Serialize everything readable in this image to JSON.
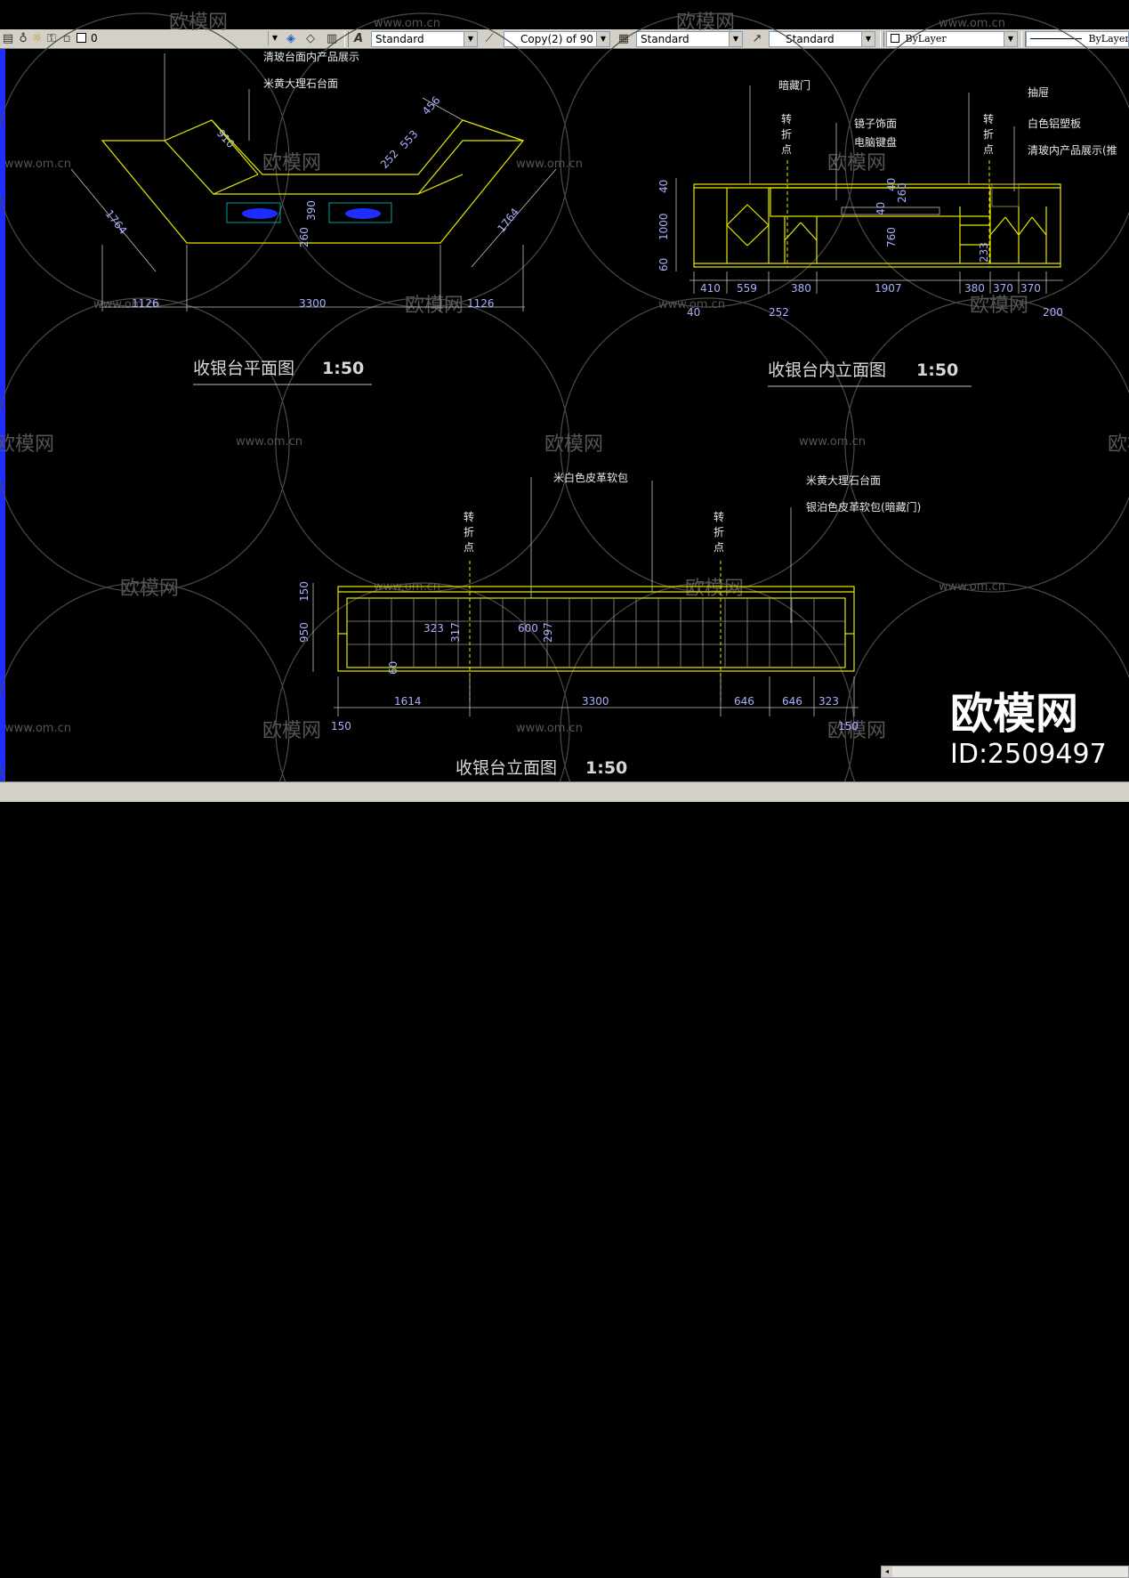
{
  "toolbar": {
    "layer_value": "0",
    "text_style": "Standard",
    "dim_style": "Copy(2) of 90",
    "table_style": "Standard",
    "mleader_style": "Standard",
    "color": "ByLayer",
    "linetype": "ByLayer"
  },
  "watermark": {
    "site": "www.om.cn",
    "brand": "欧模网",
    "corner_brand": "欧模网",
    "corner_id": "ID:2509497"
  },
  "plan_view": {
    "title": "收银台平面图",
    "scale": "1:50",
    "notes": [
      "米黄大理石台面",
      "清玻台面内产品展示"
    ],
    "dims": [
      "910",
      "456",
      "553",
      "252",
      "1764",
      "1764",
      "390",
      "260",
      "1126",
      "3300",
      "1126"
    ]
  },
  "inner_elevation": {
    "title": "收银台内立面图",
    "scale": "1:50",
    "notes": [
      "暗藏门",
      "转",
      "折",
      "点",
      "镜子饰面",
      "电脑键盘",
      "抽屉",
      "转",
      "折",
      "点",
      "白色铝塑板",
      "清玻内产品展示(推"
    ],
    "vertical_dims": [
      "40",
      "1000",
      "60"
    ],
    "inner_dims": [
      "260",
      "40",
      "760",
      "40",
      "233"
    ],
    "bottom_dims": [
      "410",
      "559",
      "380",
      "1907",
      "380",
      "370",
      "370"
    ],
    "sub_dims": [
      "40",
      "252",
      "200"
    ]
  },
  "front_elevation": {
    "title": "收银台立面图",
    "scale": "1:50",
    "notes": [
      "米白色皮革软包",
      "米黄大理石台面",
      "银泊色皮革软包(暗藏门)",
      "转",
      "折",
      "点",
      "转",
      "折",
      "点"
    ],
    "vertical_dims": [
      "150",
      "950"
    ],
    "inner_dims": [
      "323",
      "317",
      "600",
      "297",
      "60"
    ],
    "bottom_dims": [
      "1614",
      "3300",
      "646",
      "646",
      "323"
    ],
    "sub_dims": [
      "150",
      "150"
    ]
  }
}
